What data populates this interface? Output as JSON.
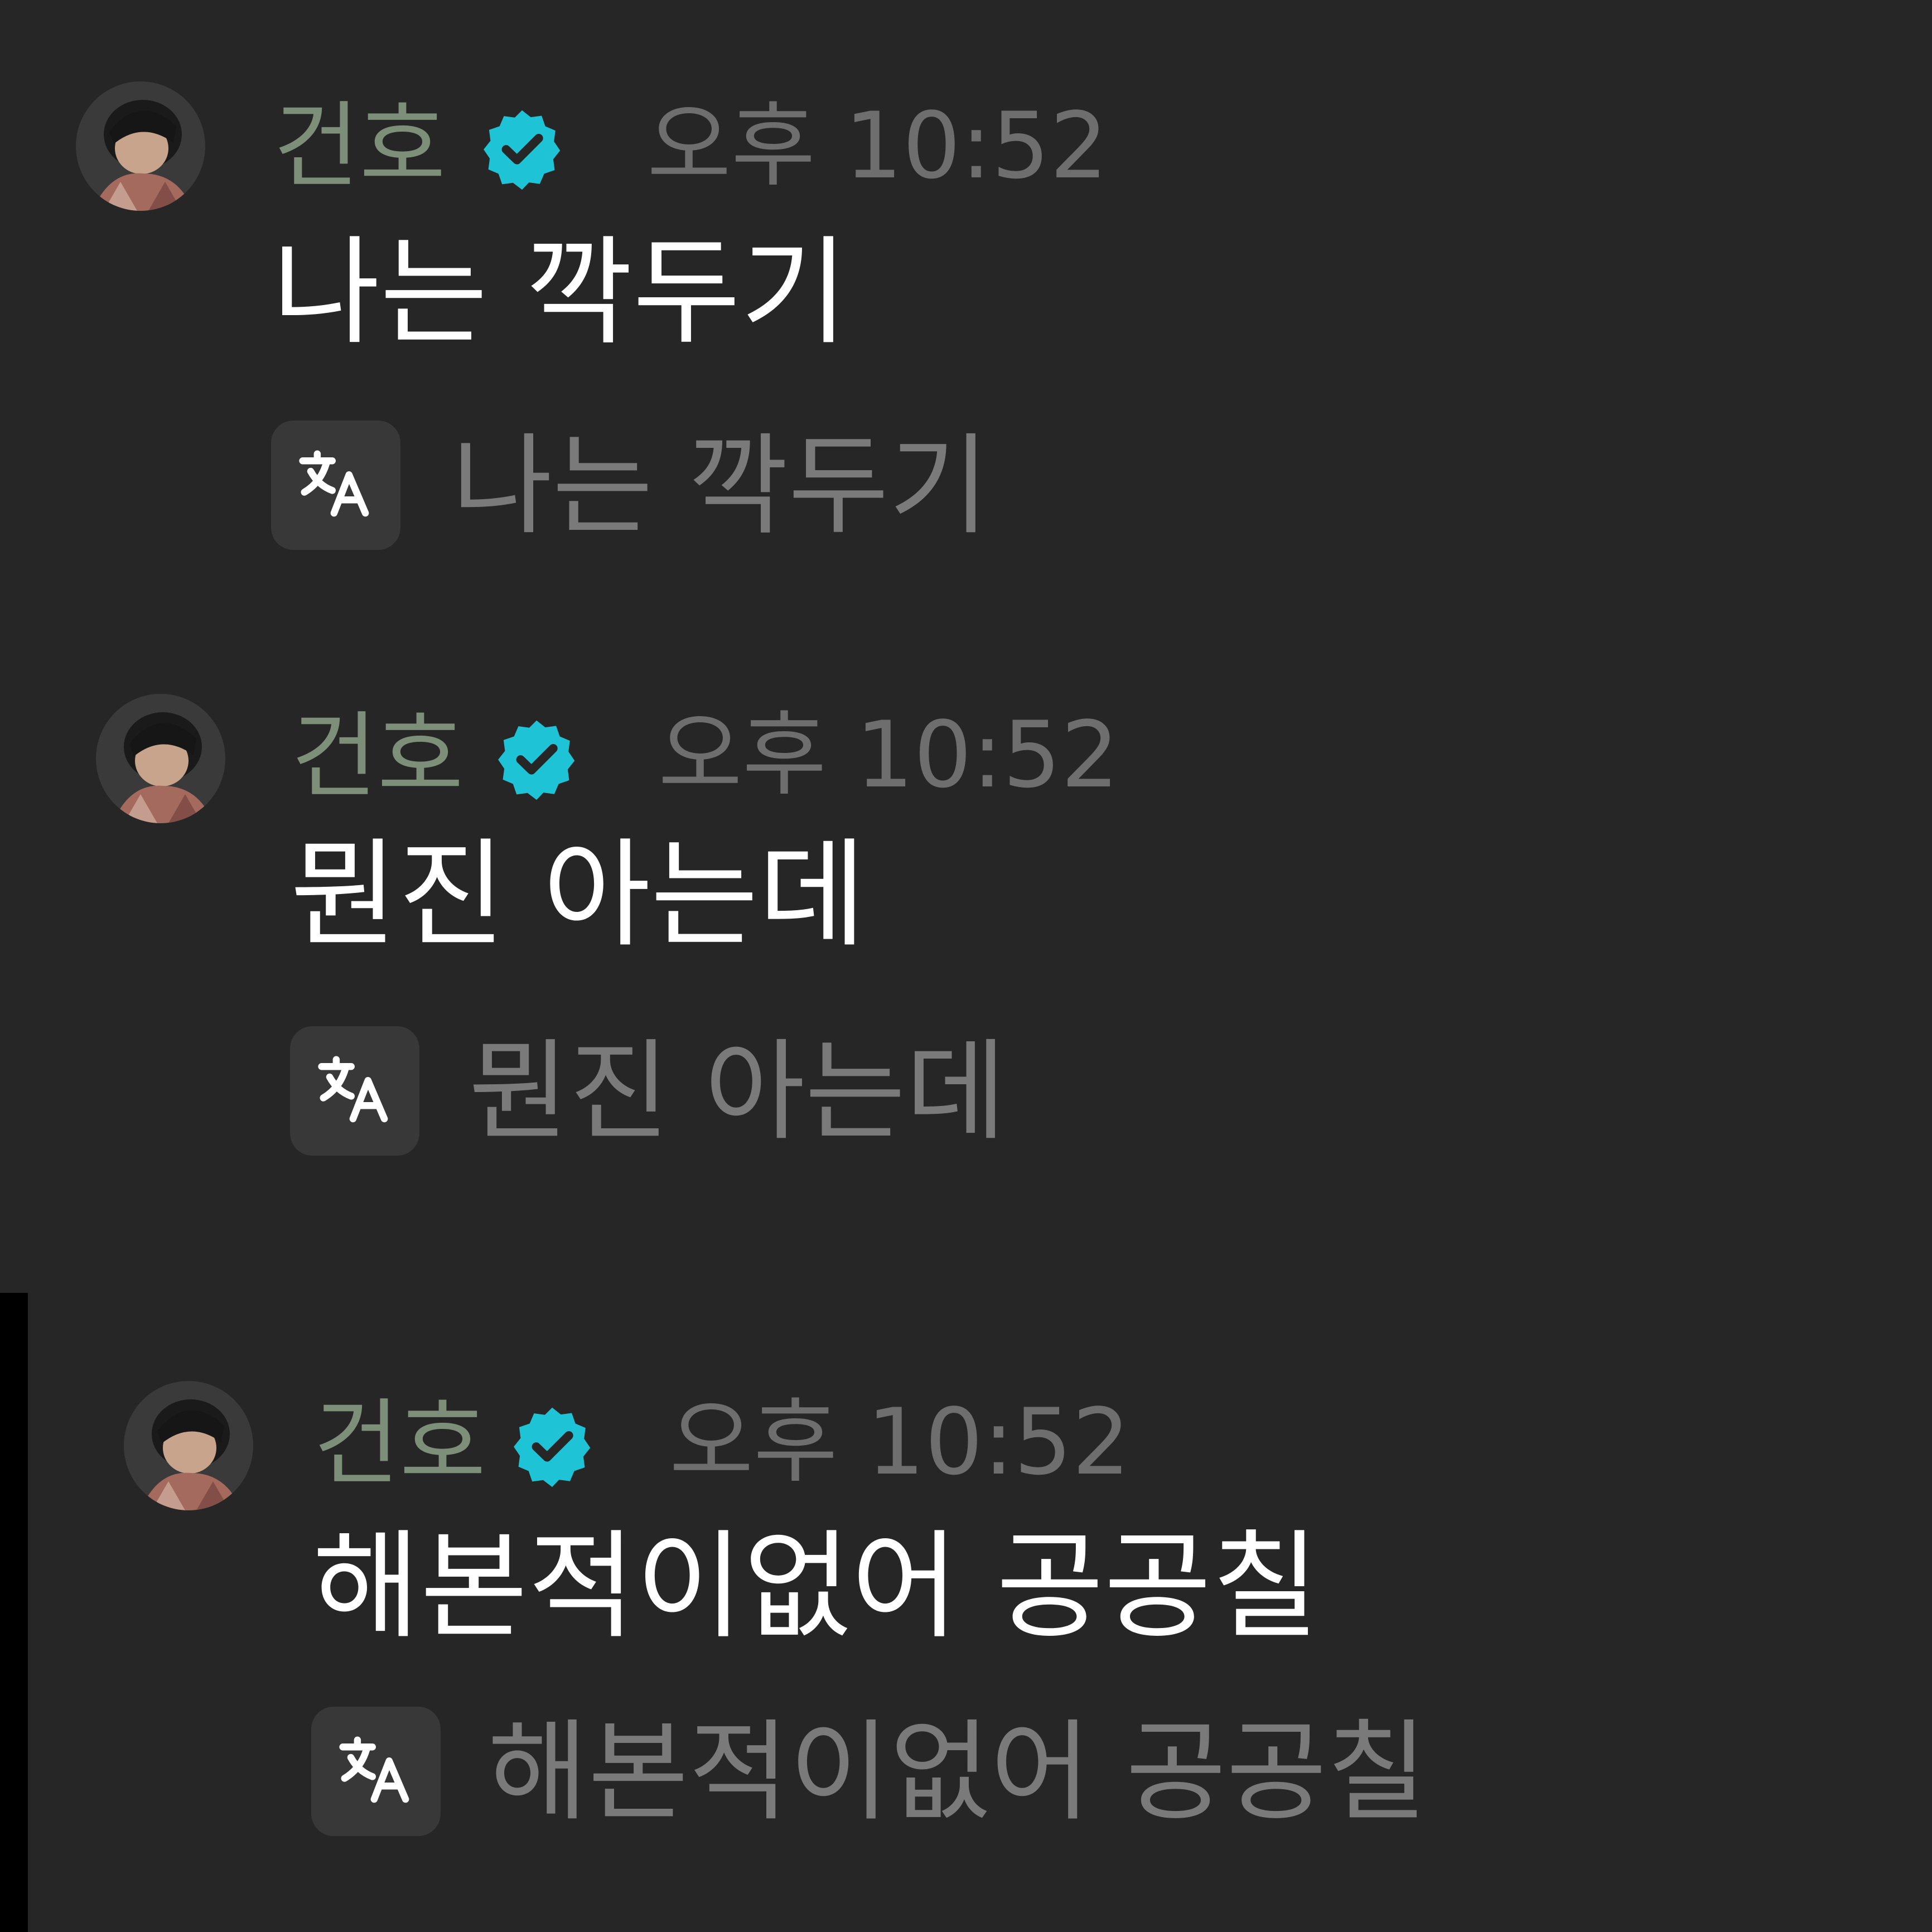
{
  "messages": [
    {
      "author": "건호",
      "time": "오후 10:52",
      "text": "나는 깍두기",
      "translation": "나는 깍두기"
    },
    {
      "author": "건호",
      "time": "오후 10:52",
      "text": "뭔진 아는데",
      "translation": "뭔진 아는데"
    },
    {
      "author": "건호",
      "time": "오후 10:52",
      "text": "해본적이없어 공공칠",
      "translation": "해본적이없어 공공칠"
    }
  ],
  "icons": {
    "badge": "verified-badge-icon",
    "translate": "translate-icon"
  },
  "colors": {
    "background": "#262626",
    "author_name": "#7d8f78",
    "verified_badge": "#1ec3d6",
    "timestamp": "#6e6e6e",
    "message_text": "#ffffff",
    "translated_text": "#7a7a7a",
    "translate_button_bg": "#383838"
  }
}
